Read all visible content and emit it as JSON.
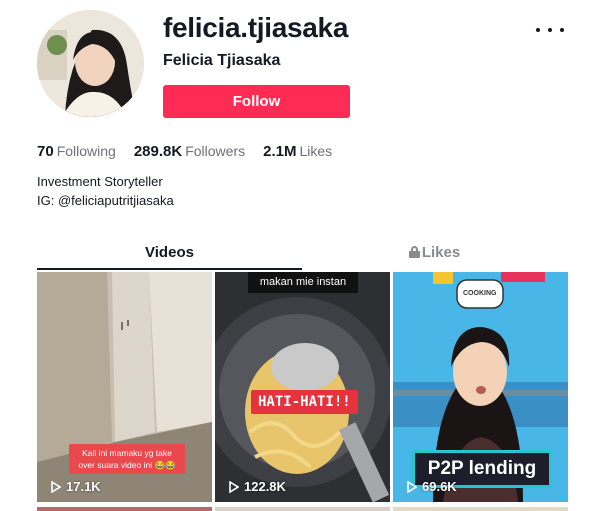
{
  "profile": {
    "username": "felicia.tjiasaka",
    "display_name": "Felicia Tjiasaka",
    "follow_label": "Follow"
  },
  "stats": [
    {
      "value": "70",
      "label": "Following"
    },
    {
      "value": "289.8K",
      "label": "Followers"
    },
    {
      "value": "2.1M",
      "label": "Likes"
    }
  ],
  "bio": {
    "line1": "Investment Storyteller",
    "line2": "IG: @feliciaputritjiasaka"
  },
  "tabs": {
    "videos": "Videos",
    "likes": "Likes"
  },
  "videos": [
    {
      "views": "17.1K",
      "caption": "Kali ini mamaku yg take over suara video ini 😂😂"
    },
    {
      "views": "122.8K",
      "top_caption": "makan mie instan",
      "overlay": "HATI-HATI!!"
    },
    {
      "views": "69.6K",
      "overlay": "P2P lending",
      "sticker": "COOKING"
    }
  ],
  "colors": {
    "accent": "#fe2c55",
    "text": "#161823",
    "muted": "#8a8b91"
  }
}
